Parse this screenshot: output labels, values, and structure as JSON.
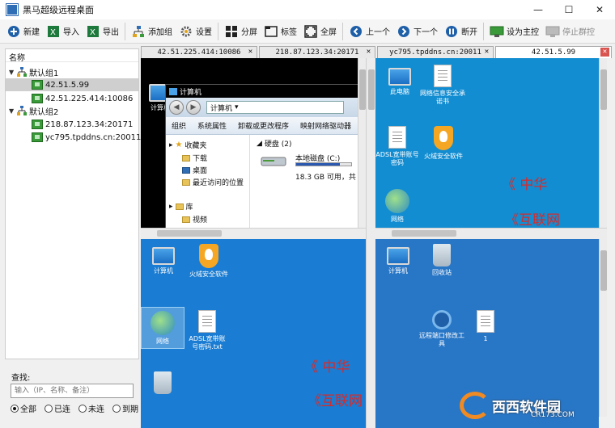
{
  "window": {
    "title": "黑马超级远程桌面",
    "controls": [
      "—",
      "☐",
      "✕"
    ]
  },
  "toolbar": {
    "new": "新建",
    "import": "导入",
    "export": "导出",
    "add_group": "添加组",
    "settings": "设置",
    "split": "分屏",
    "tabs": "标签",
    "fullscreen": "全屏",
    "prev": "上一个",
    "next": "下一个",
    "disconnect": "断开",
    "set_master": "设为主控",
    "stop_group": "停止群控"
  },
  "tree": {
    "header": "名称",
    "groups": [
      {
        "name": "默认组1",
        "items": [
          "42.51.5.99",
          "42.51.225.414:10086"
        ]
      },
      {
        "name": "默认组2",
        "items": [
          "218.87.123.34:20171",
          "yc795.tpddns.cn:20011"
        ]
      }
    ],
    "selected": "42.51.5.99"
  },
  "search": {
    "label": "查找:",
    "placeholder": "输入（IP、名称、备注）"
  },
  "filters": [
    {
      "label": "全部",
      "checked": true
    },
    {
      "label": "已连",
      "checked": false
    },
    {
      "label": "未连",
      "checked": false
    },
    {
      "label": "到期",
      "checked": false
    }
  ],
  "tabs": [
    "42.51.225.414:10086",
    "218.87.123.34:20171",
    "yc795.tpddns.cn:20011",
    "42.51.5.99"
  ],
  "pane1": {
    "desktop_label": "计算机",
    "explorer_title": "计算机",
    "address": "计算机",
    "menu": [
      "组织",
      "系统属性",
      "卸载或更改程序",
      "映射网络驱动器"
    ],
    "favorites": "收藏夹",
    "fav_items": [
      "下载",
      "桌面",
      "最近访问的位置"
    ],
    "library": "库",
    "lib_items": [
      "视频"
    ],
    "drives_header": "硬盘 (2)",
    "drive_name": "本地磁盘 (C:)",
    "drive_info": "18.3 GB 可用，共",
    "drive_used_fraction": 0.8
  },
  "pane2": {
    "icons": [
      "此电脑",
      "网络信息安全承诺书",
      "ADSL宽带账号密码",
      "火绒安全软件",
      "网络"
    ],
    "red_lines": [
      "《 中华",
      "《互联网"
    ]
  },
  "pane3": {
    "icons": [
      "计算机",
      "火绒安全软件",
      "网络",
      "ADSL宽带账号密码.txt"
    ],
    "red_lines": [
      "《 中华",
      "《互联网"
    ]
  },
  "pane4": {
    "icons": [
      "计算机",
      "回收站",
      "远程端口修改工具",
      "1"
    ]
  },
  "watermark": {
    "brand": "西西软件园",
    "site": "CR173.COM"
  }
}
